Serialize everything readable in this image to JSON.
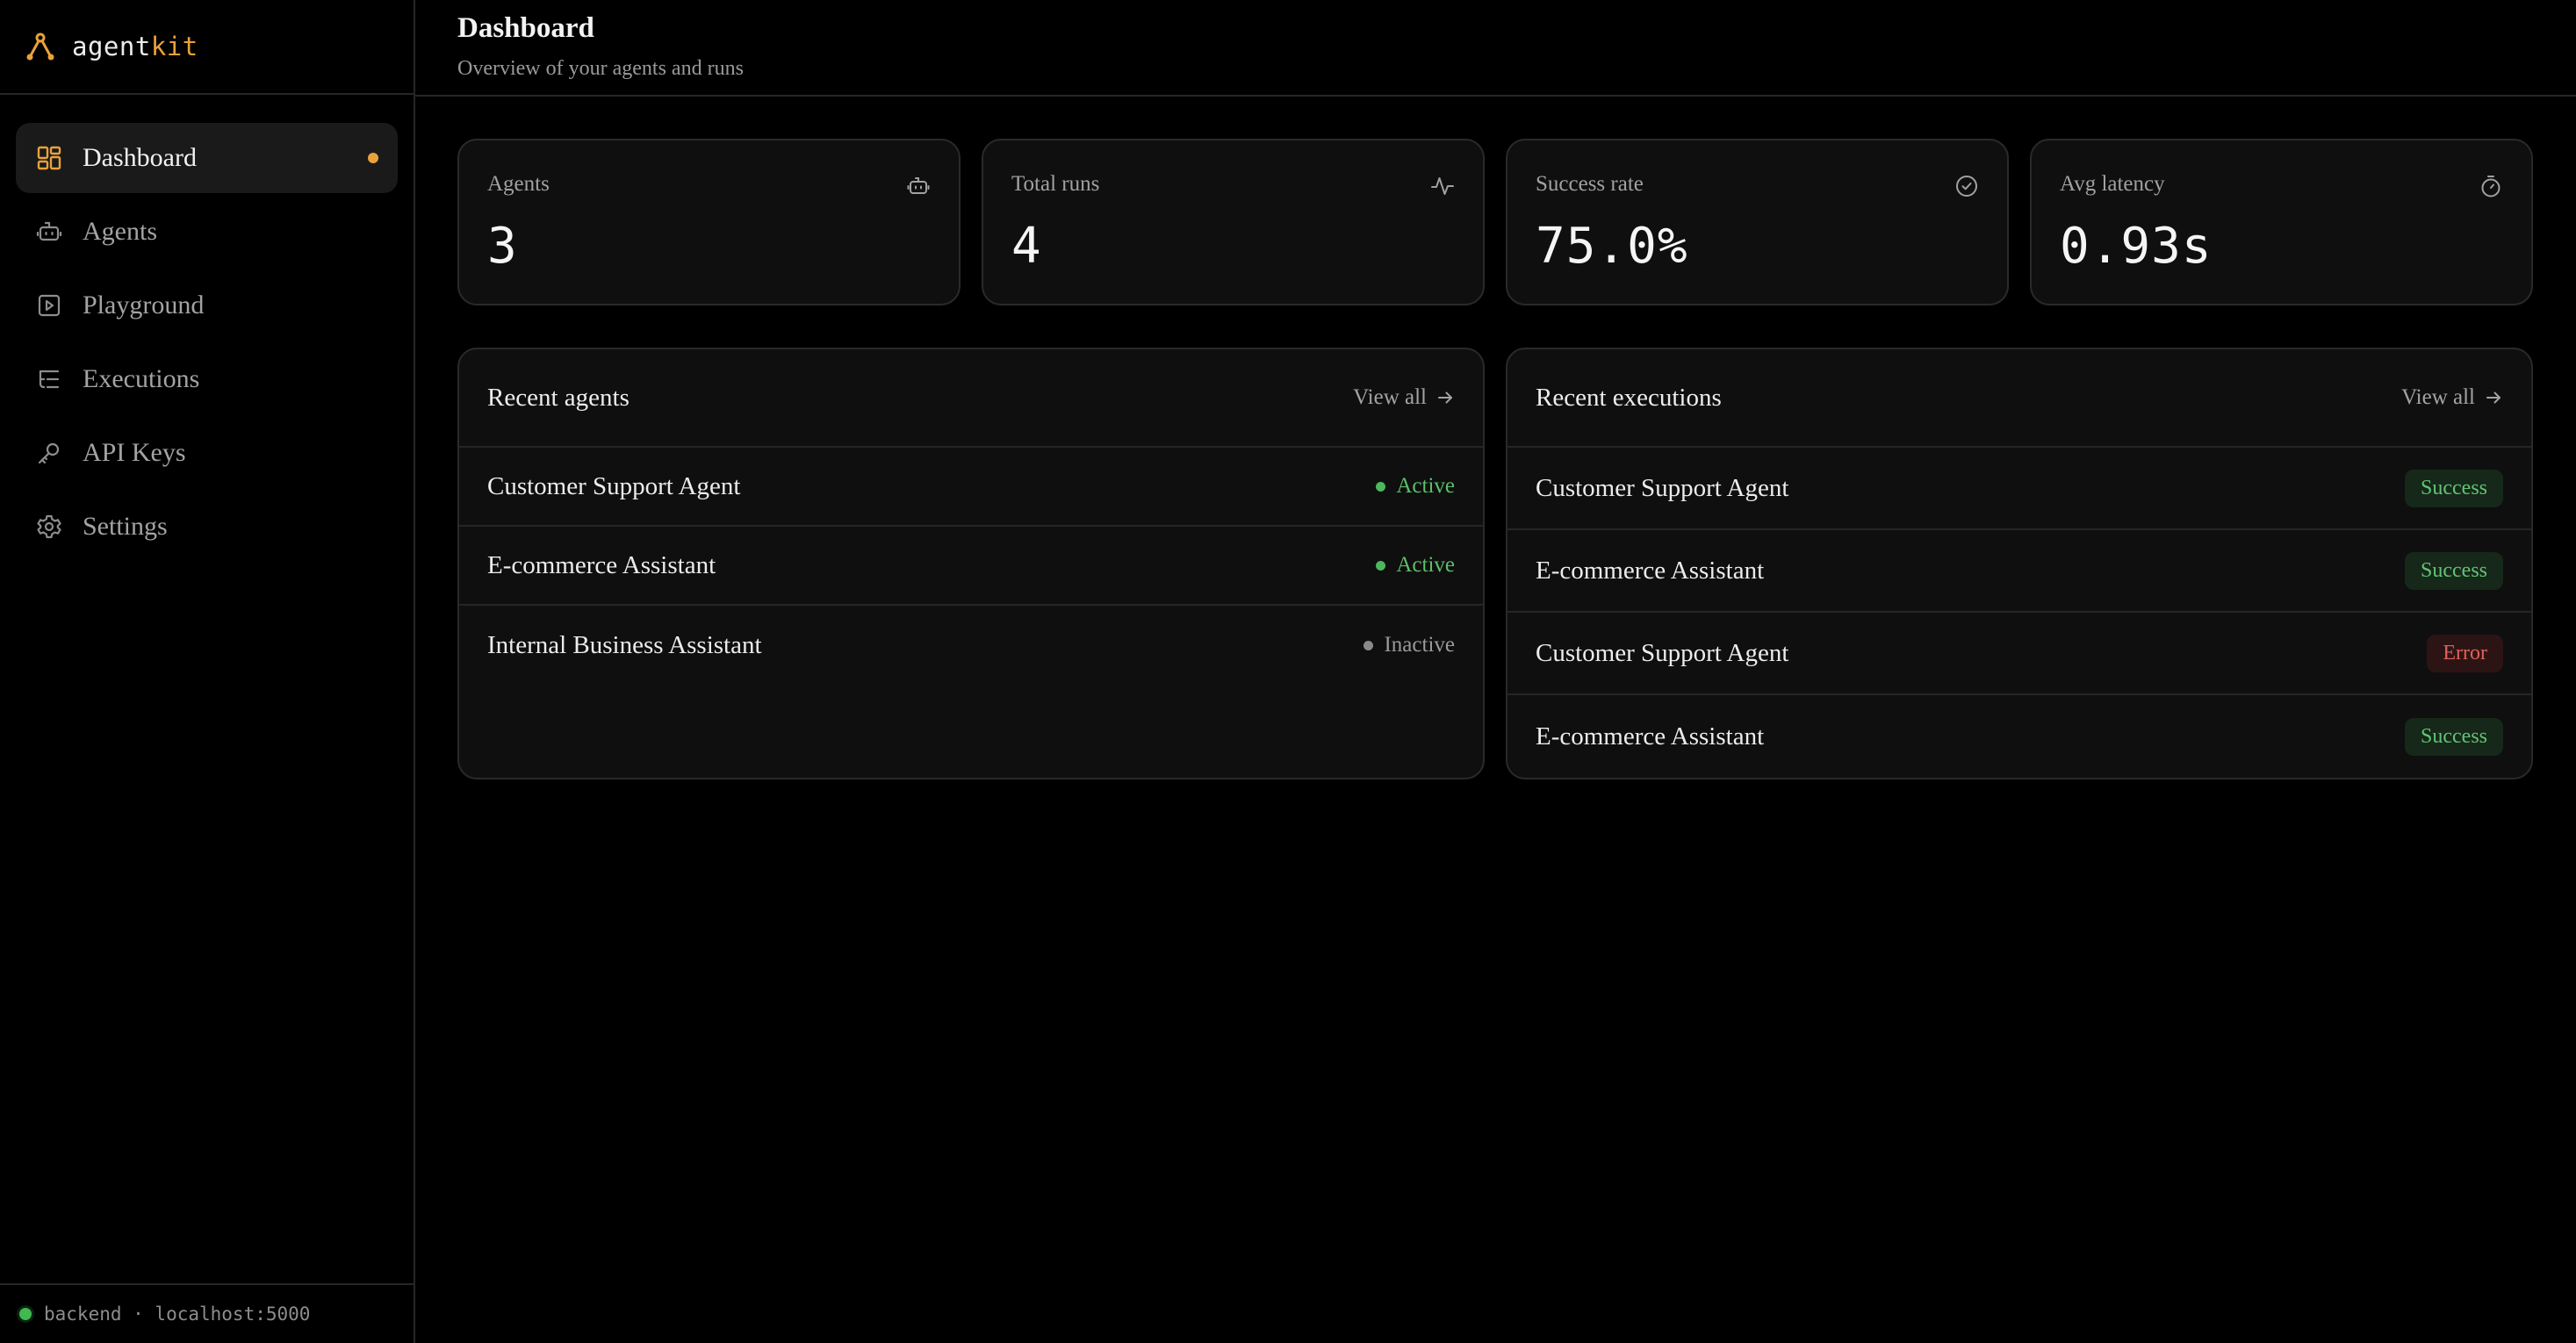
{
  "brand": {
    "name_a": "agent",
    "name_b": "kit",
    "accent": "#e9a23b"
  },
  "sidebar": {
    "items": [
      {
        "label": "Dashboard",
        "icon": "dashboard-icon",
        "active": true
      },
      {
        "label": "Agents",
        "icon": "bot-icon"
      },
      {
        "label": "Playground",
        "icon": "play-square-icon"
      },
      {
        "label": "Executions",
        "icon": "list-tree-icon"
      },
      {
        "label": "API Keys",
        "icon": "key-icon"
      },
      {
        "label": "Settings",
        "icon": "gear-icon"
      }
    ],
    "footer": {
      "text": "backend · localhost:5000",
      "status_color": "#3fb950"
    }
  },
  "header": {
    "title": "Dashboard",
    "subtitle": "Overview of your agents and runs"
  },
  "stats": [
    {
      "label": "Agents",
      "value": "3",
      "icon": "bot-icon"
    },
    {
      "label": "Total runs",
      "value": "4",
      "icon": "activity-icon"
    },
    {
      "label": "Success rate",
      "value": "75.0%",
      "icon": "check-circle-icon"
    },
    {
      "label": "Avg latency",
      "value": "0.93s",
      "icon": "timer-icon"
    }
  ],
  "recent_agents": {
    "title": "Recent agents",
    "view_all": "View all",
    "rows": [
      {
        "name": "Customer Support Agent",
        "status": "Active"
      },
      {
        "name": "E-commerce Assistant",
        "status": "Active"
      },
      {
        "name": "Internal Business Assistant",
        "status": "Inactive"
      }
    ]
  },
  "recent_executions": {
    "title": "Recent executions",
    "view_all": "View all",
    "rows": [
      {
        "name": "Customer Support Agent",
        "status": "Success"
      },
      {
        "name": "E-commerce Assistant",
        "status": "Success"
      },
      {
        "name": "Customer Support Agent",
        "status": "Error"
      },
      {
        "name": "E-commerce Assistant",
        "status": "Success"
      }
    ]
  },
  "colors": {
    "success": "#62c474",
    "error": "#e0615a",
    "inactive": "#9a9a9a"
  }
}
